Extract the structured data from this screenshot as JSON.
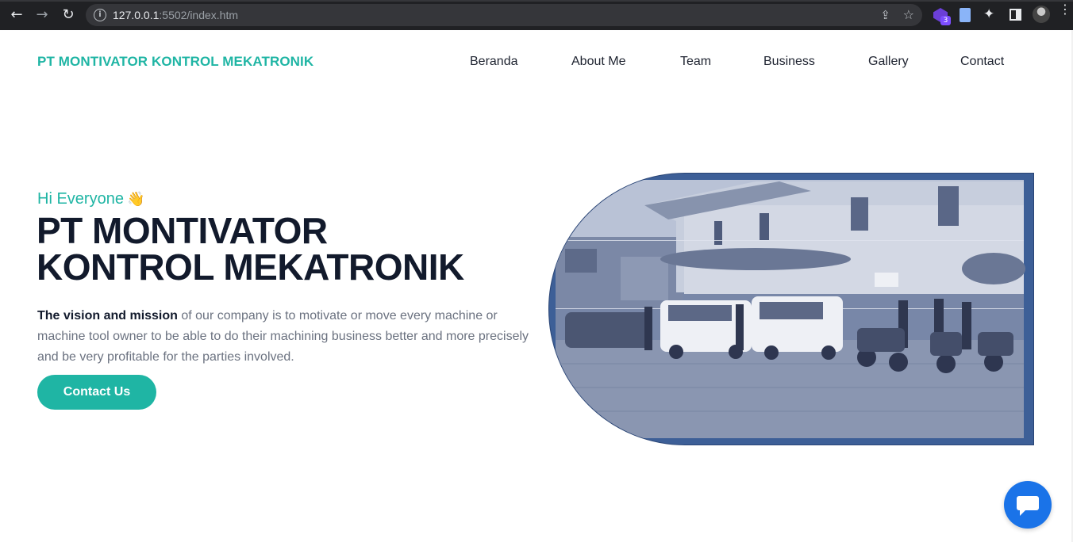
{
  "browser": {
    "url_host": "127.0.0.1",
    "url_path": ":5502/index.htm",
    "extension_badge": "3"
  },
  "header": {
    "brand": "PT MONTIVATOR KONTROL MEKATRONIK",
    "nav": [
      "Beranda",
      "About Me",
      "Team",
      "Business",
      "Gallery",
      "Contact"
    ]
  },
  "hero": {
    "greeting": "Hi Everyone",
    "greeting_emoji": "👋",
    "title_line1": "PT MONTIVATOR",
    "title_line2": "KONTROL MEKATRONIK",
    "description_bold": "The vision and mission",
    "description_rest": " of our company is to motivate or move every machine or machine tool owner to be able to do their machining business better and more precisely and be very profitable for the parties involved.",
    "cta_label": "Contact Us"
  },
  "colors": {
    "accent": "#1fb5a4",
    "heading": "#121a2c",
    "body_text": "#6b7280",
    "chat_button": "#1a73e8"
  }
}
